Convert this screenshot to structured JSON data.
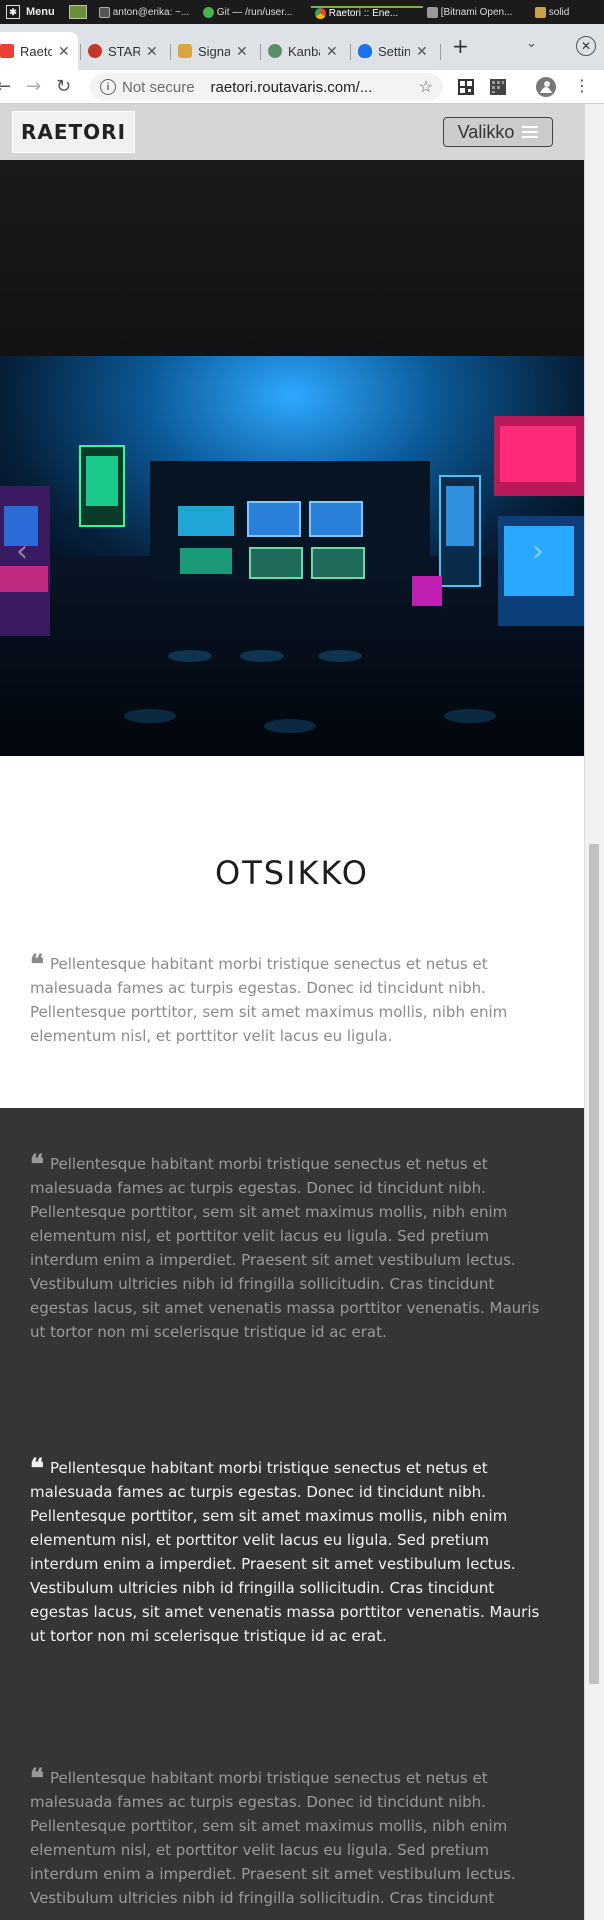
{
  "taskbar": {
    "menu_label": "Menu",
    "items": [
      {
        "label": "anton@erika: ~...",
        "color": "#888888"
      },
      {
        "label": "Git — /run/user...",
        "color": "#4caf50"
      },
      {
        "label": "Raetori :: Ene...",
        "color": "#e94335"
      },
      {
        "label": "[Bitnami Open...",
        "color": "#999999"
      },
      {
        "label": "solid",
        "color": "#c8a24a"
      }
    ]
  },
  "browser": {
    "tabs": [
      {
        "label": "Raetori :: Ene",
        "color": "#e94335",
        "active": true
      },
      {
        "label": "STAR",
        "color": "#c0392b",
        "active": false
      },
      {
        "label": "Signal",
        "color": "#d9a441",
        "active": false
      },
      {
        "label": "Kanban",
        "color": "#5b8c6b",
        "active": false
      },
      {
        "label": "Settings",
        "color": "#1a73e8",
        "active": false
      }
    ],
    "new_tab": "+",
    "not_secure": "Not secure",
    "url": "raetori.routavaris.com/..."
  },
  "site": {
    "logo": "RAETORI",
    "menu_label": "Valikko",
    "section_title": "OTSIKKO",
    "quote_short": "Pellentesque habitant morbi tristique senectus et netus et malesuada fames ac turpis egestas. Donec id tincidunt nibh. Pellentesque porttitor, sem sit amet maximus mollis, nibh enim elementum nisl, et porttitor velit lacus eu ligula.",
    "quote_long_1": "Pellentesque habitant morbi tristique senectus et netus et malesuada fames ac turpis egestas. Donec id tincidunt nibh. Pellentesque porttitor, sem sit amet maximus mollis, nibh enim elementum nisl, et porttitor velit lacus eu ligula. Sed pretium interdum enim a imperdiet. Praesent sit amet vestibulum lectus. Vestibulum ultricies nibh id fringilla sollicitudin. Cras tincidunt egestas lacus, sit amet venenatis massa porttitor venenatis. Mauris ut tortor non mi scelerisque tristique id ac erat.",
    "quote_long_2": "Pellentesque habitant morbi tristique senectus et netus et malesuada fames ac turpis egestas. Donec id tincidunt nibh. Pellentesque porttitor, sem sit amet maximus mollis, nibh enim elementum nisl, et porttitor velit lacus eu ligula. Sed pretium interdum enim a imperdiet. Praesent sit amet vestibulum lectus. Vestibulum ultricies nibh id fringilla sollicitudin. Cras tincidunt egestas lacus, sit amet venenatis massa porttitor venenatis. Mauris ut tortor non mi scelerisque tristique id ac erat.",
    "quote_long_3": "Pellentesque habitant morbi tristique senectus et netus et malesuada fames ac turpis egestas. Donec id tincidunt nibh. Pellentesque porttitor, sem sit amet maximus mollis, nibh enim elementum nisl, et porttitor velit lacus eu ligula. Sed pretium interdum enim a imperdiet. Praesent sit amet vestibulum lectus. Vestibulum ultricies nibh id fringilla sollicitudin. Cras tincidunt",
    "quote_mark": "❝",
    "carousel_prev": "‹",
    "carousel_next": "›"
  },
  "icons": {
    "back": "arrow-left-icon",
    "forward": "arrow-right-icon",
    "reload": "reload-icon",
    "star": "star-icon",
    "menu": "hamburger-icon"
  },
  "colors": {
    "header_bg": "#d6d6d6",
    "dark_bg": "#353535",
    "muted_text": "#8a8a8a",
    "dim_text": "#9a9a9a",
    "bright_text": "#f2f2f2"
  }
}
